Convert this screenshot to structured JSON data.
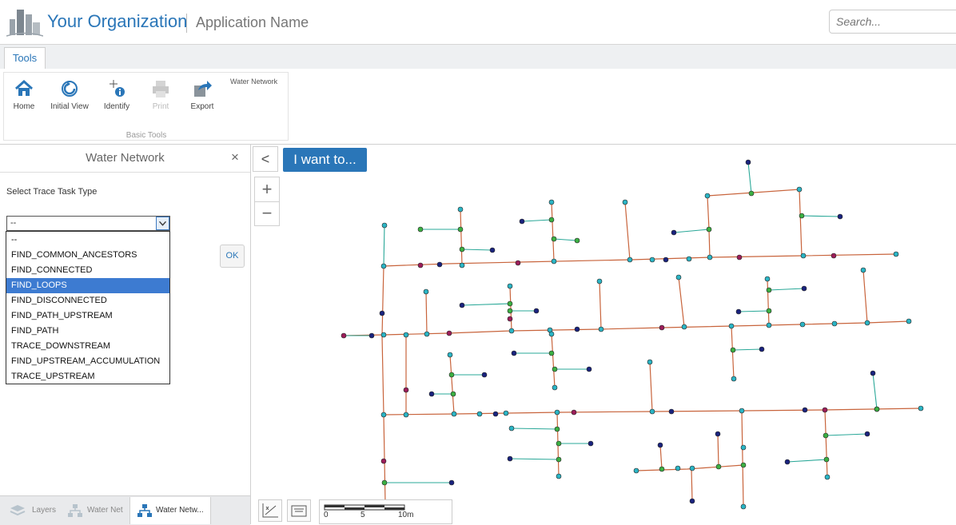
{
  "header": {
    "org_name": "Your Organization",
    "app_name": "Application Name",
    "search_placeholder": "Search..."
  },
  "ribbon": {
    "tab": "Tools",
    "group_title": "Water Network",
    "group_label": "Basic Tools",
    "buttons": [
      {
        "label": "Home",
        "icon": "home-icon",
        "enabled": true
      },
      {
        "label": "Initial View",
        "icon": "refresh-icon",
        "enabled": true
      },
      {
        "label": "Identify",
        "icon": "identify-icon",
        "enabled": true
      },
      {
        "label": "Print",
        "icon": "print-icon",
        "enabled": false
      },
      {
        "label": "Export",
        "icon": "export-icon",
        "enabled": true
      }
    ]
  },
  "panel": {
    "title": "Water Network",
    "close": "×",
    "select_label": "Select Trace Task Type",
    "selected_value": "--",
    "options": [
      "--",
      "FIND_COMMON_ANCESTORS",
      "FIND_CONNECTED",
      "FIND_LOOPS",
      "FIND_DISCONNECTED",
      "FIND_PATH_UPSTREAM",
      "FIND_PATH",
      "TRACE_DOWNSTREAM",
      "FIND_UPSTREAM_ACCUMULATION",
      "TRACE_UPSTREAM"
    ],
    "highlighted_option": "FIND_LOOPS",
    "ok": "OK"
  },
  "bottom_tabs": [
    {
      "label": "Layers",
      "icon": "layers-icon"
    },
    {
      "label": "Water Net",
      "icon": "network-icon"
    },
    {
      "label": "Water Netw...",
      "icon": "network-icon",
      "active": true
    }
  ],
  "map": {
    "i_want_to": "I want to...",
    "back": "<",
    "zoom_in": "+",
    "zoom_out": "−",
    "scale_labels": [
      "0",
      "5",
      "10m"
    ],
    "colors": {
      "pipe": "#c8643c",
      "service": "#2aa898",
      "junction": "#2bb5c5",
      "valve": "#3cb043",
      "endpoint": "#1a237e",
      "hydrant": "#9c1d5a"
    }
  }
}
